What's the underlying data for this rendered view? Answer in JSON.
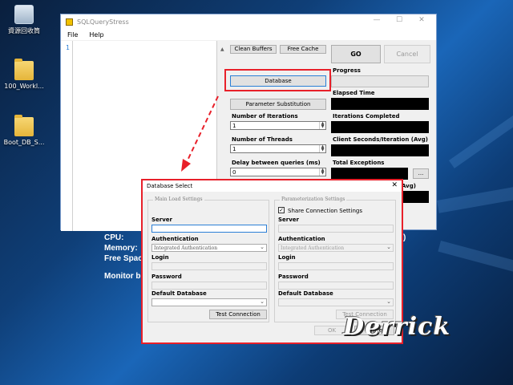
{
  "desktop": {
    "icons": [
      {
        "label": "資源回收筒",
        "icon": "recycle-bin-icon"
      },
      {
        "label": "100_Workl...",
        "icon": "folder-icon"
      },
      {
        "label": "Boot_DB_S...",
        "icon": "folder-icon"
      }
    ],
    "stats": {
      "cpu": "CPU:",
      "memory": "Memory:",
      "free_space": "Free Spac",
      "monitor": "Monitor b",
      "paren": ")"
    }
  },
  "main_window": {
    "title": "SQLQueryStress",
    "menu": [
      "File",
      "Help"
    ],
    "editor_line": "1",
    "buttons": {
      "clean_buffers": "Clean Buffers",
      "free_cache": "Free Cache",
      "go": "GO",
      "cancel": "Cancel",
      "database": "Database",
      "parameter_substitution": "Parameter Substitution",
      "ellipsis": "..."
    },
    "labels": {
      "progress": "Progress",
      "elapsed_time": "Elapsed Time",
      "iterations_completed": "Iterations Completed",
      "client_seconds": "Client Seconds/Iteration (Avg)",
      "total_exceptions": "Total Exceptions",
      "avg_fragment": "Avg)",
      "number_of_iterations": "Number of Iterations",
      "number_of_threads": "Number of Threads",
      "delay_between_queries": "Delay between queries (ms)"
    },
    "values": {
      "iterations": "1",
      "threads": "1",
      "delay": "0"
    }
  },
  "dialog": {
    "title": "Database Select",
    "close": "✕",
    "main_load": {
      "caption": "Main Load Settings",
      "server_label": "Server",
      "server_value": "",
      "authentication_label": "Authentication",
      "authentication_value": "Integrated Authentication",
      "login_label": "Login",
      "password_label": "Password",
      "default_database_label": "Default Database",
      "test_connection": "Test Connection"
    },
    "parameterization": {
      "caption": "Parameterization Settings",
      "share_checkbox": "Share Connection Settings",
      "share_checked": true,
      "server_label": "Server",
      "authentication_label": "Authentication",
      "authentication_value": "Integrated Authentication",
      "login_label": "Login",
      "password_label": "Password",
      "default_database_label": "Default Database",
      "test_connection": "Test Connection"
    },
    "ok": "OK",
    "cancel": "Cancel"
  },
  "watermark": "Derrick",
  "colors": {
    "highlight": "#e8202a",
    "desktop_dark": "#0a1f3d",
    "desktop_light": "#1a66b8"
  }
}
